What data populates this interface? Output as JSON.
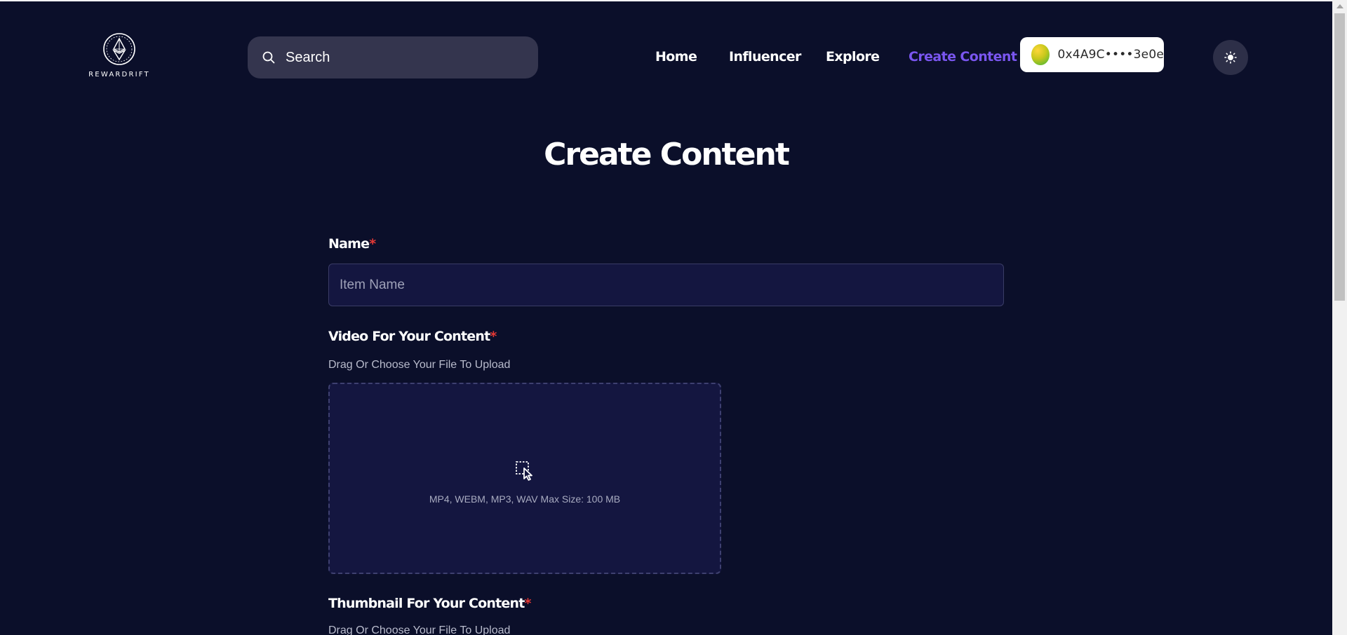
{
  "brand": {
    "name": "REWARDRIFT"
  },
  "header": {
    "search": {
      "placeholder": "Search",
      "value": ""
    },
    "nav": [
      {
        "label": "Home",
        "active": false
      },
      {
        "label": "Influencer",
        "active": false
      },
      {
        "label": "Explore",
        "active": false
      },
      {
        "label": "Create Content",
        "active": true
      }
    ],
    "wallet": {
      "address": "0x4A9C••••3e0e"
    },
    "theme_toggle_icon": "sun-icon"
  },
  "main": {
    "title": "Create Content",
    "name_field": {
      "label": "Name",
      "required_mark": "*",
      "placeholder": "Item Name",
      "value": ""
    },
    "video_field": {
      "label": "Video For Your Content",
      "required_mark": "*",
      "hint": "Drag Or Choose Your File To Upload",
      "dropzone_text": "MP4, WEBM, MP3, WAV Max Size: 100 MB",
      "icon": "upload-select-icon"
    },
    "thumbnail_field": {
      "label": "Thumbnail For Your Content",
      "required_mark": "*",
      "hint": "Drag Or Choose Your File To Upload"
    }
  },
  "colors": {
    "background": "#0b0f2a",
    "accent": "#7a56f0",
    "required": "#e53935",
    "input_bg": "#141640"
  }
}
